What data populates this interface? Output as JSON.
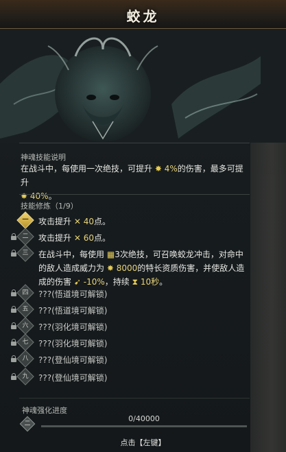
{
  "window": {
    "title": "蛟龙"
  },
  "art": {
    "subject": "azure dragon head",
    "icon": "dragon-illustration"
  },
  "skill_desc": {
    "heading": "神魂技能说明",
    "line1_a": "在战斗中，每使用一次绝技，可提升",
    "line1_val": "4%",
    "line1_b": "的伤害，最多可提升",
    "line2_val": "40%",
    "line2_b": "。"
  },
  "training": {
    "heading": "技能修炼（1/9）",
    "items": [
      {
        "numeral": "一",
        "text_a": "攻击提升",
        "value": "40",
        "text_b": "点。",
        "locked": false,
        "active": true
      },
      {
        "numeral": "二",
        "text_a": "攻击提升",
        "value": "60",
        "text_b": "点。",
        "locked": true,
        "active": false
      }
    ],
    "special": {
      "numeral": "三",
      "line1_a": "在战斗中，每使用",
      "line1_b": "3次绝技，可召唤蛟龙冲击，对命中",
      "line2_a": "的敌人造成威力为",
      "line2_val": "8000",
      "line2_b": "的特长资质伤害，并使敌人造",
      "line3_a": "成的伤害",
      "line3_val": "-10%",
      "line3_b": "，持续",
      "line3_time": "10秒",
      "line3_c": "。"
    },
    "locked_items": [
      {
        "numeral": "四",
        "text": "???(悟道境可解锁)"
      },
      {
        "numeral": "五",
        "text": "???(悟道境可解锁)"
      },
      {
        "numeral": "六",
        "text": "???(羽化境可解锁)"
      },
      {
        "numeral": "七",
        "text": "???(羽化境可解锁)"
      },
      {
        "numeral": "八",
        "text": "???(登仙境可解锁)"
      },
      {
        "numeral": "九",
        "text": "???(登仙境可解锁)"
      }
    ]
  },
  "progress": {
    "label": "神魂强化进度",
    "level": "二",
    "text": "0/40000",
    "current": 0,
    "max": 40000
  },
  "hint": "点击【左键】",
  "colors": {
    "accent_gold": "#e8d47a",
    "panel": "#171c1e"
  }
}
